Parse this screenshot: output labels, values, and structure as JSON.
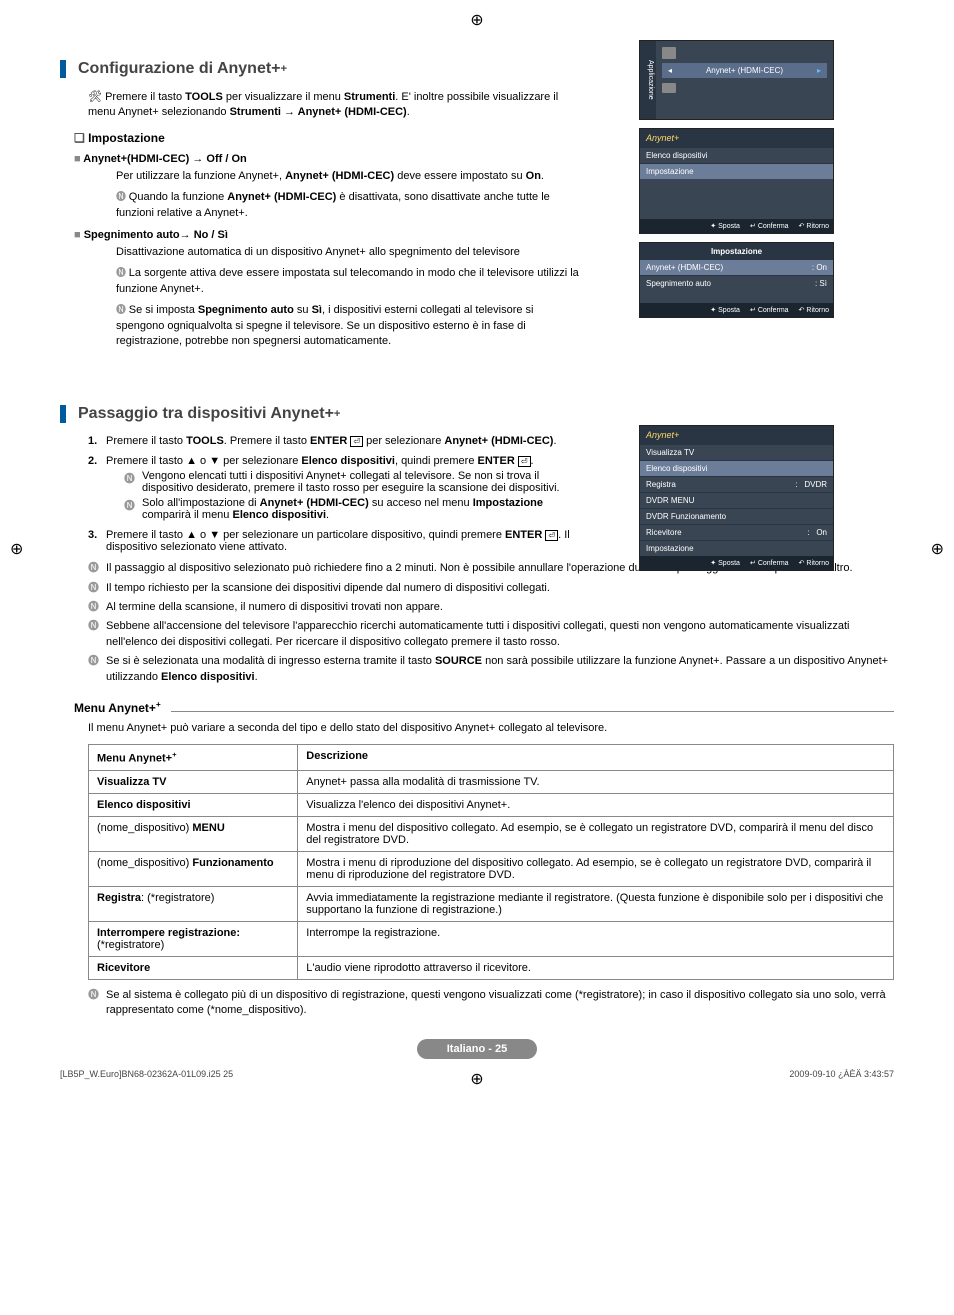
{
  "section1": {
    "title": "Configurazione di Anynet+",
    "intro_pre": "Premere il tasto ",
    "intro_tools": "TOOLS",
    "intro_mid": " per visualizzare il menu ",
    "intro_strum": "Strumenti",
    "intro_post": ". E' inoltre possibile visualizzare il menu Anynet+ selezionando ",
    "intro_path": "Strumenti → Anynet+ (HDMI-CEC)",
    "intro_end": ".",
    "sub1": "Impostazione",
    "row1": "Anynet+(HDMI-CEC) → Off / On",
    "row1_text_pre": "Per utilizzare la funzione Anynet+, ",
    "row1_text_bold": "Anynet+ (HDMI-CEC)",
    "row1_text_mid": " deve essere impostato su ",
    "row1_text_on": "On",
    "row1_text_end": ".",
    "row1_note_pre": "Quando la funzione ",
    "row1_note_bold": "Anynet+ (HDMI-CEC)",
    "row1_note_post": " è disattivata, sono disattivate anche tutte le funzioni relative a Anynet+.",
    "row2": "Spegnimento auto→ No / Sì",
    "row2_text": "Disattivazione automatica di un dispositivo Anynet+ allo spegnimento del televisore",
    "row2_note1": "La sorgente attiva deve essere impostata sul telecomando in modo che il televisore utilizzi la funzione Anynet+.",
    "row2_note2_pre": "Se si imposta ",
    "row2_note2_b1": "Spegnimento auto",
    "row2_note2_mid": " su ",
    "row2_note2_b2": "Sì",
    "row2_note2_post": ", i dispositivi esterni collegati al televisore si spengono ogniqualvolta si spegne il televisore. Se un dispositivo esterno è in fase di registrazione, potrebbe non spegnersi automaticamente."
  },
  "osd_tv": {
    "side": "Applicazione",
    "item": "Anynet+ (HDMI-CEC)"
  },
  "osd1": {
    "header": "Anynet+",
    "r1": "Elenco dispositivi",
    "r2": "Impostazione",
    "f1": "Sposta",
    "f2": "Conferma",
    "f3": "Ritorno"
  },
  "osd2": {
    "header": "Impostazione",
    "r1l": "Anynet+ (HDMI-CEC)",
    "r1r": ": On",
    "r2l": "Spegnimento auto",
    "r2r": ": Sì",
    "f1": "Sposta",
    "f2": "Conferma",
    "f3": "Ritorno"
  },
  "section2": {
    "title": "Passaggio tra dispositivi Anynet+",
    "s1_pre": "Premere il tasto ",
    "s1_tools": "TOOLS",
    "s1_mid": ". Premere il tasto ",
    "s1_enter": "ENTER",
    "s1_post": " per selezionare ",
    "s1_target": "Anynet+ (HDMI-CEC)",
    "s1_end": ".",
    "s2_pre": "Premere il tasto ▲ o ▼ per selezionare ",
    "s2_b": "Elenco dispositivi",
    "s2_mid": ", quindi premere ",
    "s2_enter": "ENTER",
    "s2_end": ".",
    "s2_n1": "Vengono elencati tutti i dispositivi Anynet+ collegati al televisore. Se non si trova il dispositivo desiderato, premere il tasto rosso per eseguire la scansione dei dispositivi.",
    "s2_n2_pre": "Solo all'impostazione di ",
    "s2_n2_b1": "Anynet+ (HDMI-CEC)",
    "s2_n2_mid": " su acceso nel menu ",
    "s2_n2_b2": "Impostazione",
    "s2_n2_mid2": " comparirà il menu ",
    "s2_n2_b3": "Elenco dispositivi",
    "s2_n2_end": ".",
    "s3_pre": "Premere il tasto ▲ o ▼ per selezionare un particolare dispositivo, quindi premere ",
    "s3_enter": "ENTER",
    "s3_post": ". Il dispositivo selezionato viene attivato.",
    "n1": "Il passaggio al dispositivo selezionato può richiedere fino a 2 minuti. Non è possibile annullare l'operazione durante il passaggio da un dispositivo all'altro.",
    "n2": "Il tempo richiesto per la scansione dei dispositivi dipende dal numero di dispositivi collegati.",
    "n3": "Al termine della scansione, il numero di dispositivi trovati non appare.",
    "n4": "Sebbene all'accensione del televisore l'apparecchio ricerchi automaticamente tutti i dispositivi collegati, questi non vengono automaticamente visualizzati nell'elenco dei dispositivi collegati. Per ricercare il dispositivo collegato premere il tasto rosso.",
    "n5_pre": "Se si è selezionata una modalità di ingresso esterna tramite il tasto ",
    "n5_b": "SOURCE",
    "n5_mid": " non sarà possibile utilizzare la funzione Anynet+. Passare a un dispositivo Anynet+ utilizzando ",
    "n5_b2": "Elenco dispositivi",
    "n5_end": "."
  },
  "osd3": {
    "header": "Anynet+",
    "r1": "Visualizza TV",
    "r2": "Elenco dispositivi",
    "r3l": "Registra",
    "r3r": "DVDR",
    "r4": "DVDR MENU",
    "r5": "DVDR Funzionamento",
    "r6l": "Ricevitore",
    "r6r": "On",
    "r7": "Impostazione",
    "f1": "Sposta",
    "f2": "Conferma",
    "f3": "Ritorno"
  },
  "menu": {
    "title": "Menu Anynet+",
    "intro": "Il menu Anynet+ può variare a seconda del tipo e dello stato del dispositivo Anynet+ collegato al televisore.",
    "h1": "Menu Anynet+",
    "h2": "Descrizione",
    "rows": [
      {
        "c1": "Visualizza TV",
        "c2": "Anynet+ passa alla modalità di trasmissione TV."
      },
      {
        "c1": "Elenco dispositivi",
        "c2": "Visualizza l'elenco dei dispositivi Anynet+."
      },
      {
        "c1": "(nome_dispositivo) MENU",
        "c1b": "MENU",
        "c2": "Mostra i menu del dispositivo collegato. Ad esempio, se è collegato un registratore DVD, comparirà il menu del disco del registratore DVD."
      },
      {
        "c1": "(nome_dispositivo) Funzionamento",
        "c1b": "Funzionamento",
        "c2": "Mostra i menu di riproduzione del dispositivo collegato. Ad esempio, se è collegato un registratore DVD, comparirà il menu di riproduzione del registratore DVD."
      },
      {
        "c1": "Registra: (*registratore)",
        "c1b": "Registra",
        "c2": "Avvia immediatamente la registrazione mediante il registratore. (Questa funzione è disponibile solo per i dispositivi che supportano la funzione di registrazione.)"
      },
      {
        "c1": "Interrompere registrazione: (*registratore)",
        "c1b": "Interrompere registrazione:",
        "c2": "Interrompe la registrazione."
      },
      {
        "c1": "Ricevitore",
        "c2": "L'audio viene riprodotto attraverso il ricevitore."
      }
    ],
    "note": "Se al sistema è collegato più di un dispositivo di registrazione, questi vengono visualizzati come (*registratore); in caso il dispositivo collegato sia uno solo, verrà rappresentato come (*nome_dispositivo)."
  },
  "footer": {
    "page": "Italiano - 25",
    "left": "[LB5P_W.Euro]BN68-02362A-01L09.i25   25",
    "right": "2009-09-10   ¿ÀÈÄ 3:43:57"
  }
}
